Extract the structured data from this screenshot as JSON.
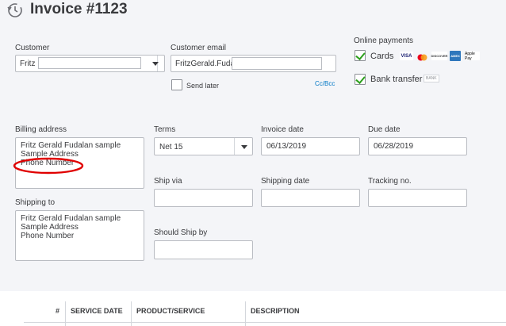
{
  "header": {
    "title": "Invoice #1123",
    "icon": "clock-history-icon"
  },
  "customer": {
    "label": "Customer",
    "value": "Fritz"
  },
  "email": {
    "label": "Customer email",
    "value": "FritzGerald.Fuda",
    "send_later": "Send later",
    "cc_bcc": "Cc/Bcc"
  },
  "online_payments": {
    "label": "Online payments",
    "cards_label": "Cards",
    "cards_checked": true,
    "card_logos": [
      "VISA",
      "mastercard",
      "DISCOVER",
      "AMEX",
      "Apple Pay"
    ],
    "bank_label": "Bank transfer",
    "bank_checked": true,
    "bank_badge": "BANK"
  },
  "billing": {
    "label": "Billing address",
    "lines": [
      "Fritz Gerald Fudalan sample",
      "Sample Address",
      "Phone Number"
    ]
  },
  "shipping_to": {
    "label": "Shipping to",
    "lines": [
      "Fritz Gerald Fudalan sample",
      "Sample Address",
      "Phone Number"
    ]
  },
  "terms": {
    "label": "Terms",
    "value": "Net 15"
  },
  "invoice_date": {
    "label": "Invoice date",
    "value": "06/13/2019"
  },
  "due_date": {
    "label": "Due date",
    "value": "06/28/2019"
  },
  "ship_via": {
    "label": "Ship via",
    "value": ""
  },
  "shipping_date": {
    "label": "Shipping date",
    "value": ""
  },
  "tracking_no": {
    "label": "Tracking no.",
    "value": ""
  },
  "should_ship_by": {
    "label": "Should Ship by",
    "value": ""
  },
  "table": {
    "columns": [
      "#",
      "SERVICE DATE",
      "PRODUCT/SERVICE",
      "DESCRIPTION"
    ]
  },
  "colors": {
    "annotation": "#e00000",
    "check": "#2ca01c",
    "link": "#0077c5"
  }
}
